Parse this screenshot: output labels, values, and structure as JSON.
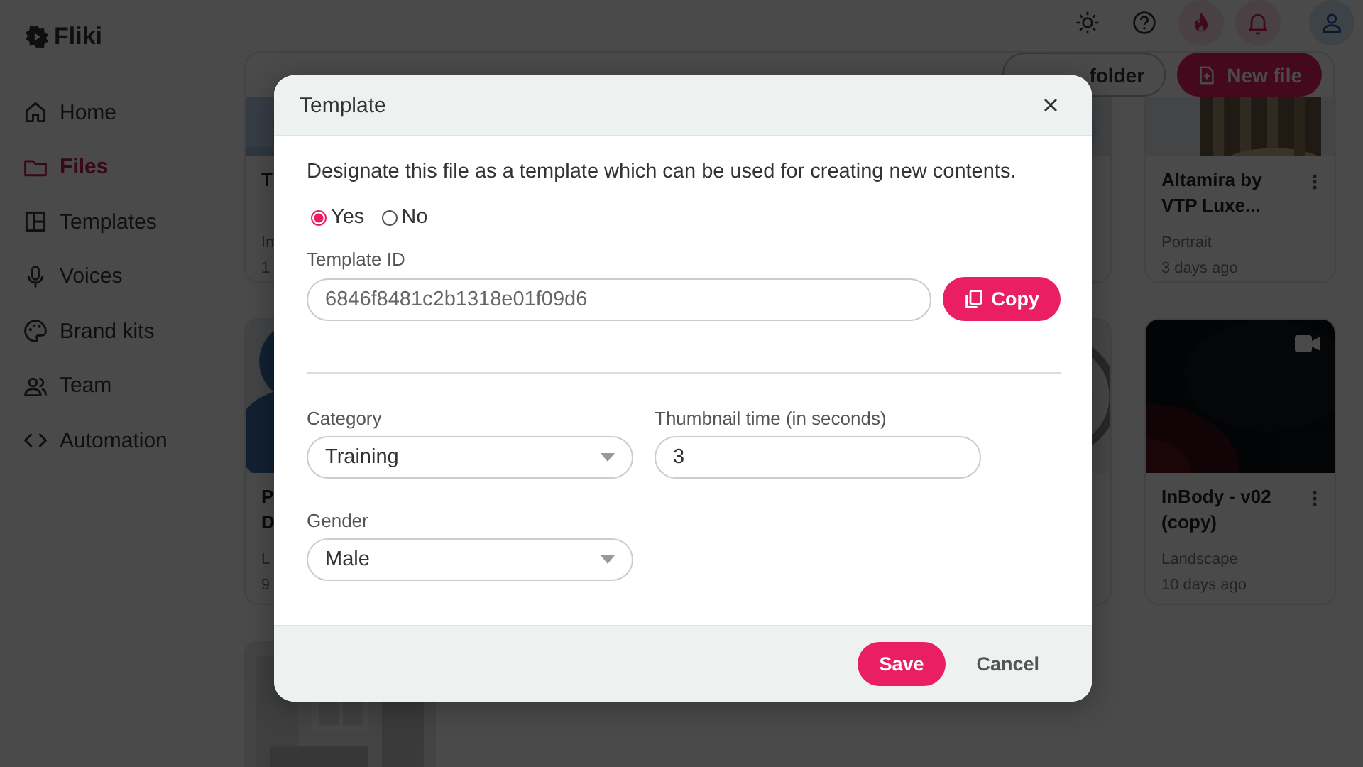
{
  "logo": {
    "text": "Fliki"
  },
  "sidebar": {
    "items": [
      {
        "label": "Home",
        "selected": false
      },
      {
        "label": "Files",
        "selected": true
      },
      {
        "label": "Templates",
        "selected": false
      },
      {
        "label": "Voices",
        "selected": false
      },
      {
        "label": "Brand kits",
        "selected": false
      },
      {
        "label": "Team",
        "selected": false
      },
      {
        "label": "Automation",
        "selected": false
      }
    ]
  },
  "header": {
    "icons": [
      {
        "kind": "sun"
      },
      {
        "kind": "help"
      },
      {
        "kind": "flame"
      },
      {
        "kind": "bell"
      },
      {
        "kind": "user"
      }
    ]
  },
  "toolbar": {
    "buttons": [
      {
        "label": "folder",
        "kind": "outline"
      },
      {
        "label": "New file",
        "kind": "primary"
      }
    ]
  },
  "cards": [
    {
      "kind": "file",
      "title": "T",
      "type": "In",
      "time": "1"
    },
    {
      "kind": "picture"
    },
    {
      "kind": "file",
      "title": "Altamira by\nVTP Luxe...",
      "type": "Portrait",
      "time": "3 days ago",
      "menu": true
    },
    {
      "kind": "file",
      "title": "P\nD",
      "type": "L",
      "time": "9"
    },
    {
      "kind": "picture"
    },
    {
      "kind": "file",
      "title": "InBody - v02\n(copy)",
      "type": "Landscape",
      "time": "10 days ago",
      "video": true,
      "menu": true
    },
    {
      "kind": "picture"
    }
  ],
  "modal": {
    "title": "Template",
    "description": "Designate this file as a template which can be used for creating new contents.",
    "options": [
      {
        "label": "Yes",
        "selected": true
      },
      {
        "label": "No",
        "selected": false
      }
    ],
    "template_id": {
      "label": "Template ID",
      "value": "6846f8481c2b1318e01f09d6"
    },
    "copy_button": "Copy",
    "category": {
      "label": "Category",
      "value": "Training"
    },
    "thumbnail_time": {
      "label": "Thumbnail time (in seconds)",
      "value": "3"
    },
    "gender": {
      "label": "Gender",
      "value": "Male"
    },
    "buttons": [
      {
        "label": "Save",
        "kind": "primary"
      },
      {
        "label": "Cancel",
        "kind": "text"
      }
    ]
  }
}
